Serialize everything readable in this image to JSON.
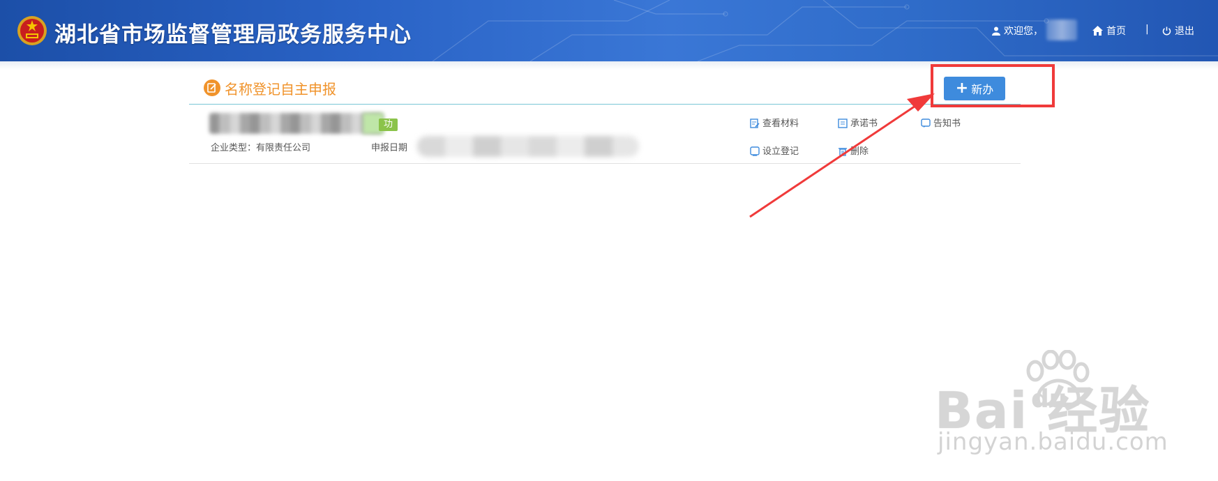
{
  "header": {
    "title": "湖北省市场监督管理局政务服务中心",
    "welcome": "欢迎您，",
    "home_label": "首页",
    "separator": "|",
    "logout_label": "退出",
    "icons": {
      "user": "user-icon",
      "home": "home-icon",
      "logout": "power-icon",
      "emblem": "national-emblem-icon"
    }
  },
  "section": {
    "title": "名称登记自主申报",
    "new_button_label": "新办"
  },
  "record": {
    "status_tag": "功",
    "company_type_label": "企业类型：",
    "company_type_value": "有限责任公司",
    "apply_date_label": "申报日期",
    "actions": [
      {
        "label": "查看材料",
        "icon": "document-edit-icon"
      },
      {
        "label": "承诺书",
        "icon": "document-icon"
      },
      {
        "label": "告知书",
        "icon": "notice-icon"
      },
      {
        "label": "设立登记",
        "icon": "register-icon"
      },
      {
        "label": "删除",
        "icon": "trash-icon"
      }
    ]
  },
  "watermark": {
    "main": "Bai  经验",
    "du": "du",
    "sub": "jingyan.baidu.com"
  },
  "colors": {
    "header_blue": "#2a63c6",
    "accent_orange": "#f0932b",
    "button_blue": "#3e8bdd",
    "success_green": "#8bc34a",
    "annotation_red": "#f03a3a"
  }
}
